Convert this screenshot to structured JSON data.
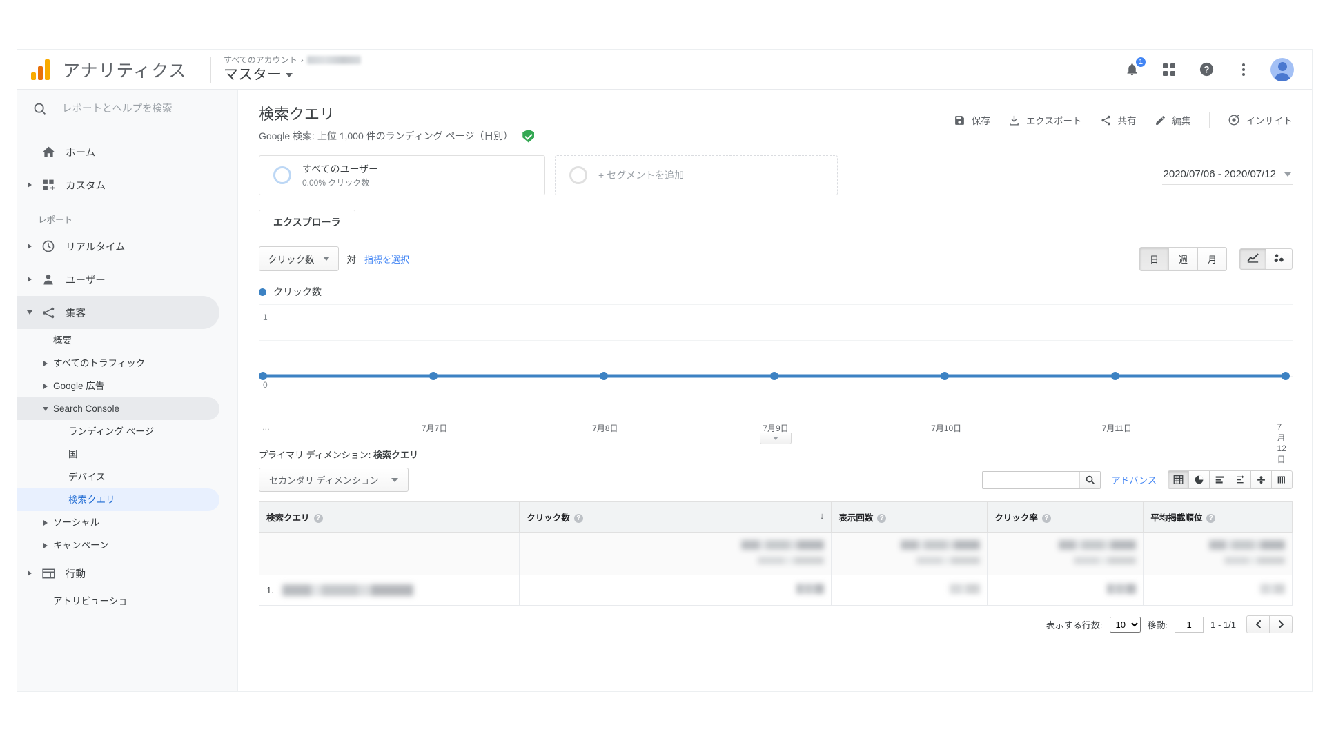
{
  "header": {
    "brand": "アナリティクス",
    "account_breadcrumb": "すべてのアカウント",
    "property_name": "マスター",
    "notification_count": "1"
  },
  "sidebar": {
    "search_placeholder": "レポートとヘルプを検索",
    "top_items": [
      {
        "label": "ホーム",
        "icon": "home-icon",
        "expandable": false
      },
      {
        "label": "カスタム",
        "icon": "custom-icon",
        "expandable": true
      }
    ],
    "section_label": "レポート",
    "report_items": [
      {
        "label": "リアルタイム",
        "icon": "clock-icon"
      },
      {
        "label": "ユーザー",
        "icon": "person-icon"
      },
      {
        "label": "集客",
        "icon": "acquisition-icon"
      }
    ],
    "acquisition_children": [
      {
        "label": "概要",
        "arrow": false
      },
      {
        "label": "すべてのトラフィック",
        "arrow": true
      },
      {
        "label": "Google 広告",
        "arrow": true
      },
      {
        "label": "Search Console",
        "arrow": true,
        "open": true
      }
    ],
    "search_console_children": [
      {
        "label": "ランディング ページ",
        "selected": false
      },
      {
        "label": "国",
        "selected": false
      },
      {
        "label": "デバイス",
        "selected": false
      },
      {
        "label": "検索クエリ",
        "selected": true
      }
    ],
    "acquisition_tail": [
      {
        "label": "ソーシャル",
        "arrow": true
      },
      {
        "label": "キャンペーン",
        "arrow": true
      }
    ],
    "bottom_items": [
      {
        "label": "行動",
        "icon": "behavior-icon"
      },
      {
        "label": "アトリビューショ",
        "icon": ""
      }
    ]
  },
  "report": {
    "title": "検索クエリ",
    "subtitle": "Google 検索: 上位 1,000 件のランディング ページ（日別）",
    "actions": [
      {
        "label": "保存",
        "icon": "save-icon"
      },
      {
        "label": "エクスポート",
        "icon": "export-icon"
      },
      {
        "label": "共有",
        "icon": "share-icon"
      },
      {
        "label": "編集",
        "icon": "edit-icon"
      },
      {
        "label": "インサイト",
        "icon": "insights-icon"
      }
    ],
    "segments": {
      "primary_name": "すべてのユーザー",
      "primary_stat": "0.00% クリック数",
      "add_label": "+ セグメントを追加"
    },
    "date_range": "2020/07/06 - 2020/07/12",
    "tab": "エクスプローラ",
    "metric_selector": "クリック数",
    "versus_label": "対",
    "select_metric_link": "指標を選択",
    "granularity": [
      {
        "label": "日",
        "active": true
      },
      {
        "label": "週",
        "active": false
      },
      {
        "label": "月",
        "active": false
      }
    ],
    "chart_types": [
      {
        "icon": "line-chart-icon",
        "active": true
      },
      {
        "icon": "scatter-chart-icon",
        "active": false
      }
    ]
  },
  "chart_data": {
    "type": "line",
    "title": "クリック数",
    "legend": [
      "クリック数"
    ],
    "series": [
      {
        "name": "クリック数",
        "values": [
          0,
          0,
          0,
          0,
          0,
          0,
          0
        ],
        "color": "#3c82c3"
      }
    ],
    "categories": [
      "...",
      "7月7日",
      "7月8日",
      "7月9日",
      "7月10日",
      "7月11日",
      "7月12日"
    ],
    "xlabel": "",
    "ylabel": "",
    "ytick_labels": [
      "1",
      "0"
    ],
    "ylim": [
      0,
      1
    ],
    "grid": true,
    "legend_position": "top-left"
  },
  "table_section": {
    "primary_dimension_label": "プライマリ ディメンション:",
    "primary_dimension_value": "検索クエリ",
    "secondary_dimension": "セカンダリ ディメンション",
    "search_value": "",
    "advanced_link": "アドバンス",
    "view_types": [
      {
        "icon": "table-view-icon",
        "active": true
      },
      {
        "icon": "pie-view-icon",
        "active": false
      },
      {
        "icon": "bar-view-icon",
        "active": false
      },
      {
        "icon": "comparison-view-icon",
        "active": false
      },
      {
        "icon": "pivot-view-icon",
        "active": false
      },
      {
        "icon": "column-view-icon",
        "active": false
      }
    ],
    "columns": [
      {
        "label": "検索クエリ",
        "sorted": false
      },
      {
        "label": "クリック数",
        "sorted": true
      },
      {
        "label": "表示回数",
        "sorted": false
      },
      {
        "label": "クリック率",
        "sorted": false
      },
      {
        "label": "平均掲載順位",
        "sorted": false
      }
    ],
    "rows": [
      {
        "index": "",
        "query": "",
        "redacted": true
      },
      {
        "index": "1.",
        "query": "",
        "redacted": true
      }
    ],
    "pagination": {
      "rows_label": "表示する行数:",
      "rows_value": "10",
      "goto_label": "移動:",
      "goto_value": "1",
      "range_label": "1 - 1/1"
    }
  }
}
